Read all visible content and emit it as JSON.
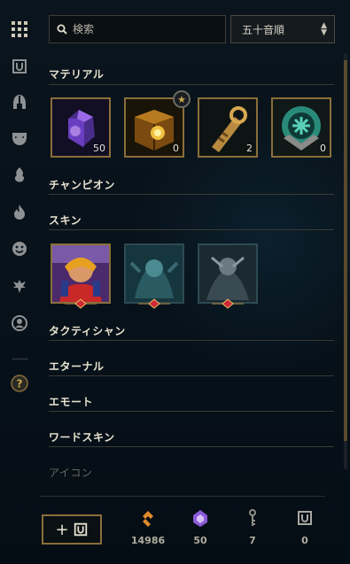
{
  "sidebar": {
    "items": [
      {
        "icon": "grid-icon"
      },
      {
        "icon": "loot-chest-icon"
      },
      {
        "icon": "helmet-icon"
      },
      {
        "icon": "mask-icon"
      },
      {
        "icon": "flame-leaf-icon"
      },
      {
        "icon": "fire-icon"
      },
      {
        "icon": "smiley-icon"
      },
      {
        "icon": "ward-icon"
      },
      {
        "icon": "profile-icon"
      },
      {
        "icon": "help-icon"
      }
    ]
  },
  "search": {
    "placeholder": "検索"
  },
  "sort": {
    "value": "五十音順",
    "arrow": "⌃⌄"
  },
  "sections": {
    "materials": {
      "title": "マテリアル",
      "items": [
        {
          "icon": "purple-gem-icon",
          "count": "50"
        },
        {
          "icon": "gold-chest-icon",
          "count": "0"
        },
        {
          "icon": "key-fragment-icon",
          "count": "2"
        },
        {
          "icon": "emblem-icon",
          "count": "0"
        }
      ],
      "badge": "★"
    },
    "champion": {
      "title": "チャンピオン"
    },
    "skin": {
      "title": "スキン",
      "items": 3
    },
    "tactician": {
      "title": "タクティシャン"
    },
    "eternal": {
      "title": "エターナル"
    },
    "emote": {
      "title": "エモート"
    },
    "ward_skin": {
      "title": "ワードスキン"
    },
    "icon": {
      "title": "アイコン"
    }
  },
  "footer": {
    "add_label": "+",
    "currencies": [
      {
        "icon": "blue-essence-icon",
        "value": "14986",
        "color": "#e08a2a"
      },
      {
        "icon": "mythic-essence-icon",
        "value": "50",
        "color": "#9b6ae0"
      },
      {
        "icon": "key-icon",
        "value": "7",
        "color": "#8e8e86"
      },
      {
        "icon": "chest-icon",
        "value": "0",
        "color": "#a8a8a0"
      }
    ]
  }
}
